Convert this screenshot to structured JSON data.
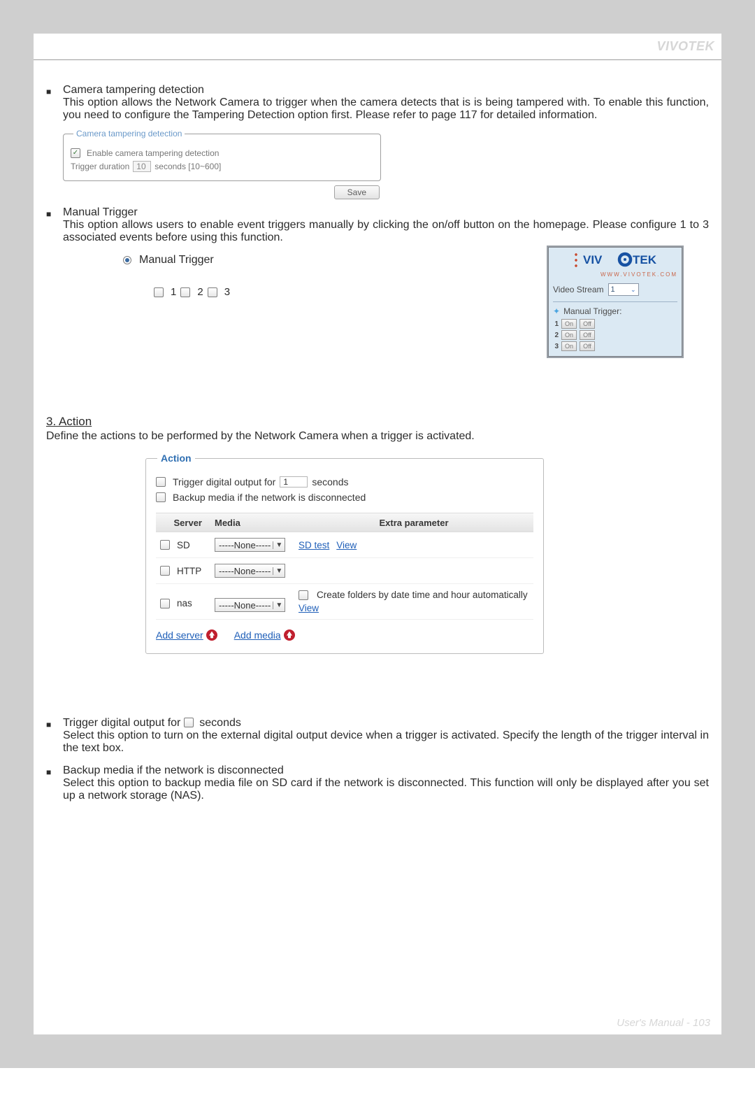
{
  "brand_header": "VIVOTEK",
  "footer": {
    "label": "User's Manual - ",
    "page": "103"
  },
  "tampering_section": {
    "title": "Camera tampering detection",
    "body": "This option allows the Network Camera to trigger when the camera detects that is is being tampered with. To enable this function, you need to configure the Tampering Detection option first. Please refer to page 117 for detailed information.",
    "fieldset_title": "Camera tampering detection",
    "enable_label": "Enable camera tampering detection",
    "trigger_label": "Trigger duration",
    "trigger_value": "10",
    "trigger_unit": "seconds [10~600]",
    "save_btn": "Save"
  },
  "manual_trigger_section": {
    "title": "Manual Trigger",
    "body": "This option allows users to enable event triggers manually by clicking the on/off button on the homepage. Please configure 1 to 3 associated events before using this function.",
    "radio_label": "Manual Trigger",
    "cb_labels": [
      "1",
      "2",
      "3"
    ]
  },
  "right_panel": {
    "logo_text": "VIVOTEK",
    "logo_url": "WWW.VIVOTEK.COM",
    "video_stream_label": "Video Stream",
    "video_stream_value": "1",
    "mt_label": "Manual Trigger:",
    "rows": [
      {
        "n": "1",
        "on": "On",
        "off": "Off"
      },
      {
        "n": "2",
        "on": "On",
        "off": "Off"
      },
      {
        "n": "3",
        "on": "On",
        "off": "Off"
      }
    ]
  },
  "action": {
    "heading": "3. Action",
    "lead": "Define the actions to be performed by the Network Camera when a trigger is activated.",
    "fieldset_title": "Action",
    "trigger_out_prefix": "Trigger digital output for",
    "trigger_out_value": "1",
    "trigger_out_suffix": "seconds",
    "backup_label": "Backup media if the network is disconnected",
    "cols": {
      "server": "Server",
      "media": "Media",
      "extra": "Extra parameter"
    },
    "rows": [
      {
        "server": "SD",
        "media": "-----None-----",
        "extra_links": [
          "SD test",
          "View"
        ],
        "extra_cb_label": ""
      },
      {
        "server": "HTTP",
        "media": "-----None-----",
        "extra_links": [],
        "extra_cb_label": ""
      },
      {
        "server": "nas",
        "media": "-----None-----",
        "extra_links": [
          "View"
        ],
        "extra_cb_label": "Create folders by date time and hour automatically"
      }
    ],
    "add_server": "Add server",
    "add_media": "Add media"
  },
  "lower_bullets": {
    "b1_prefix": "Trigger digital output for ",
    "b1_suffix": " seconds",
    "b1_body": "Select this option to turn on the external digital output device when a trigger is activated. Specify the length of the trigger interval in the text box.",
    "b2_title": "Backup media if the network is disconnected",
    "b2_body": "Select this option to backup media file on SD card if the network is disconnected. This function will only be displayed after you set up a network storage (NAS)."
  }
}
